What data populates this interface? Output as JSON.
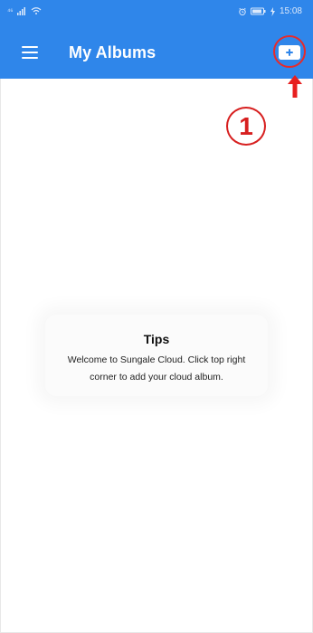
{
  "status_bar": {
    "signal_text": "⁴⁶",
    "time": "15:08",
    "icons": [
      "signal-icon",
      "wifi-icon",
      "alarm-icon",
      "battery-icon",
      "charging-icon"
    ]
  },
  "header": {
    "title": "My Albums",
    "menu_icon": "hamburger-menu-icon",
    "add_button_icon": "add-album-icon"
  },
  "annotation": {
    "step_number": "1",
    "highlight": "add-album-button",
    "color": "#d71f1f"
  },
  "empty_state": {
    "title": "Tips",
    "message": "Welcome to Sungale Cloud. Click top right corner to add your cloud album."
  },
  "colors": {
    "app_bar": "#2f86ea",
    "background": "#ffffff",
    "annotation_red": "#d71f1f"
  }
}
